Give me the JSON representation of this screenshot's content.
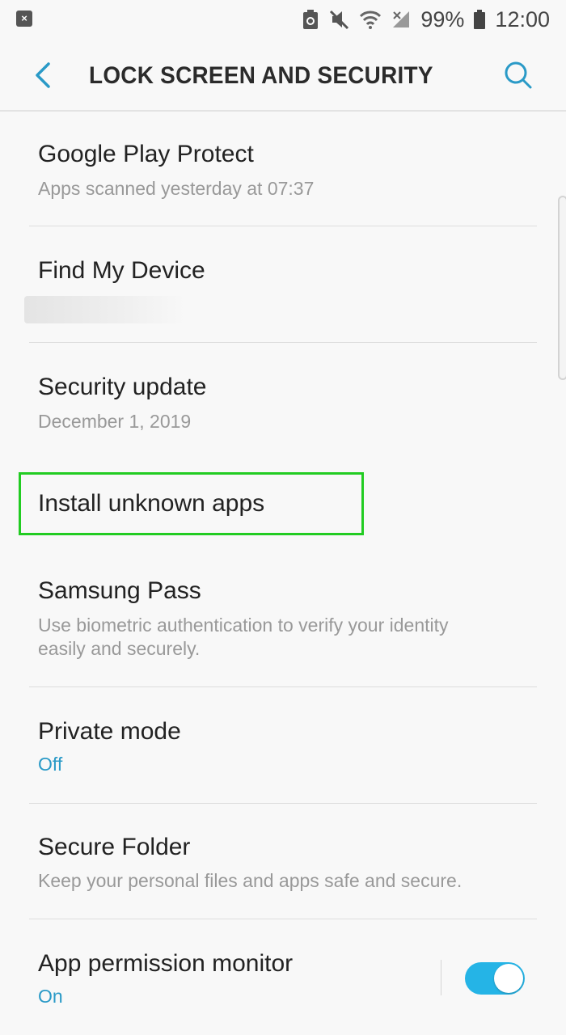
{
  "status_bar": {
    "battery_percent": "99%",
    "time": "12:00",
    "icons": [
      "notification-icon",
      "sync-icon",
      "mute-icon",
      "wifi-icon",
      "signal-icon",
      "battery-icon"
    ]
  },
  "app_bar": {
    "title": "LOCK SCREEN AND SECURITY",
    "back_icon": "chevron-left-icon",
    "search_icon": "search-icon"
  },
  "items": [
    {
      "title": "Google Play Protect",
      "subtitle": "Apps scanned yesterday at 07:37"
    },
    {
      "title": "Find My Device",
      "subtitle": ""
    },
    {
      "title": "Security update",
      "subtitle": "December 1, 2019"
    },
    {
      "title": "Install unknown apps"
    },
    {
      "title": "Samsung Pass",
      "subtitle_line1": "Use biometric authentication to verify your identity",
      "subtitle_line2": "easily and securely."
    },
    {
      "title": "Private mode",
      "subtitle": "Off"
    },
    {
      "title": "Secure Folder",
      "subtitle": "Keep your personal files and apps safe and secure."
    },
    {
      "title": "App permission monitor",
      "subtitle": "On",
      "toggle_on": true
    }
  ],
  "colors": {
    "accent": "#2a9ac7",
    "toggle": "#25b4e6",
    "highlight": "#22cc22",
    "background": "#f8f8f8"
  }
}
